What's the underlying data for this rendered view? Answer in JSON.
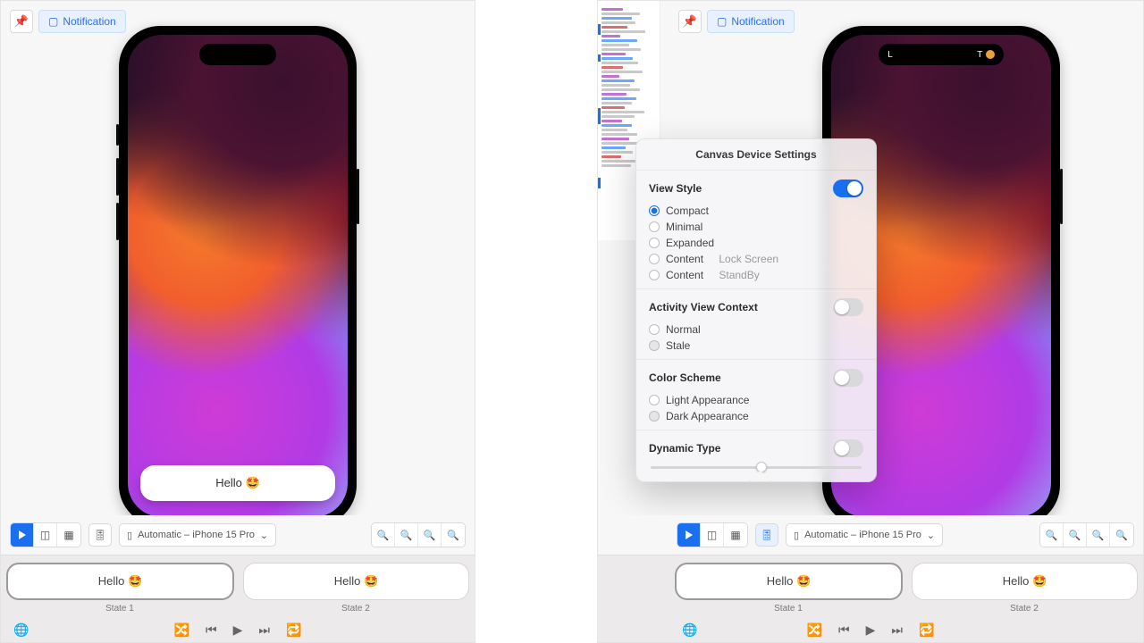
{
  "notification_label": "Notification",
  "device_selector": "Automatic – iPhone 15 Pro",
  "notif_text": "Hello 🤩",
  "island_right": {
    "l": "L",
    "t": "T"
  },
  "states": {
    "s1": {
      "text": "Hello 🤩",
      "label": "State 1"
    },
    "s2": {
      "text": "Hello 🤩",
      "label": "State 2"
    }
  },
  "popover": {
    "title": "Canvas Device Settings",
    "view_style": {
      "title": "View Style",
      "compact": "Compact",
      "minimal": "Minimal",
      "expanded": "Expanded",
      "content_lock": "Content",
      "content_lock_suffix": "Lock Screen",
      "content_standby": "Content",
      "content_standby_suffix": "StandBy"
    },
    "avc": {
      "title": "Activity View Context",
      "normal": "Normal",
      "stale": "Stale"
    },
    "color_scheme": {
      "title": "Color Scheme",
      "light": "Light Appearance",
      "dark": "Dark Appearance"
    },
    "dynamic_type": {
      "title": "Dynamic Type"
    }
  }
}
